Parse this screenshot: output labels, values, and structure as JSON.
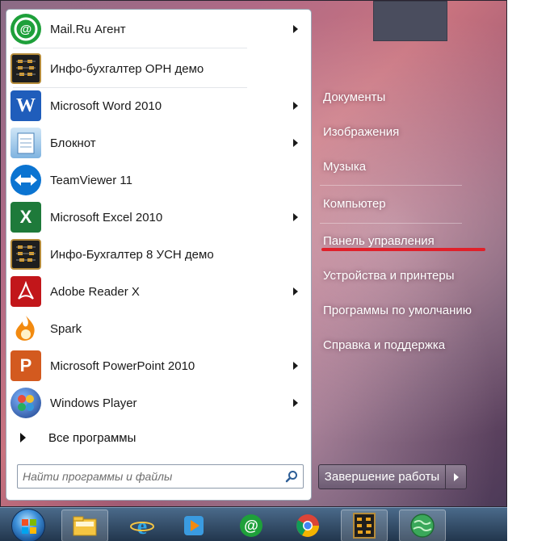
{
  "programs": [
    {
      "label": "Mail.Ru Агент",
      "icon": "mailru-agent-icon",
      "color": "#1ea03a",
      "has_arrow": true
    },
    {
      "label": "Инфо-бухгалтер ОРН демо",
      "icon": "abacus-icon",
      "color": "#1e1e1e",
      "has_arrow": false
    },
    {
      "label": "Microsoft Word 2010",
      "icon": "word-icon",
      "color": "#1f5dbb",
      "has_arrow": true
    },
    {
      "label": "Блокнот",
      "icon": "notepad-icon",
      "color": "#6aa2d6",
      "has_arrow": true
    },
    {
      "label": "TeamViewer 11",
      "icon": "teamviewer-icon",
      "color": "#0b74d1",
      "has_arrow": false
    },
    {
      "label": "Microsoft Excel 2010",
      "icon": "excel-icon",
      "color": "#1e7a3a",
      "has_arrow": true
    },
    {
      "label": "Инфо-Бухгалтер 8 УСН демо",
      "icon": "abacus-icon",
      "color": "#1e1e1e",
      "has_arrow": false
    },
    {
      "label": "Adobe Reader X",
      "icon": "adobe-reader-icon",
      "color": "#c2161a",
      "has_arrow": true
    },
    {
      "label": "Spark",
      "icon": "spark-icon",
      "color": "#f28a10",
      "has_arrow": false
    },
    {
      "label": "Microsoft PowerPoint 2010",
      "icon": "powerpoint-icon",
      "color": "#d35a1f",
      "has_arrow": true
    },
    {
      "label": "Windows Player",
      "icon": "windows-player-icon",
      "color": "#2a5aa8",
      "has_arrow": true
    }
  ],
  "all_programs": "Все программы",
  "search": {
    "placeholder": "Найти программы и файлы"
  },
  "right_links": [
    "Документы",
    "Изображения",
    "Музыка",
    "Компьютер",
    "Панель управления",
    "Устройства и принтеры",
    "Программы по умолчанию",
    "Справка и поддержка"
  ],
  "shutdown": "Завершение работы",
  "taskbar": [
    "file-explorer-icon",
    "internet-explorer-icon",
    "media-player-icon",
    "mailru-agent-icon",
    "chrome-icon",
    "abacus-icon",
    "globe-icon"
  ],
  "accent": {
    "highlight": "#e0202a"
  }
}
